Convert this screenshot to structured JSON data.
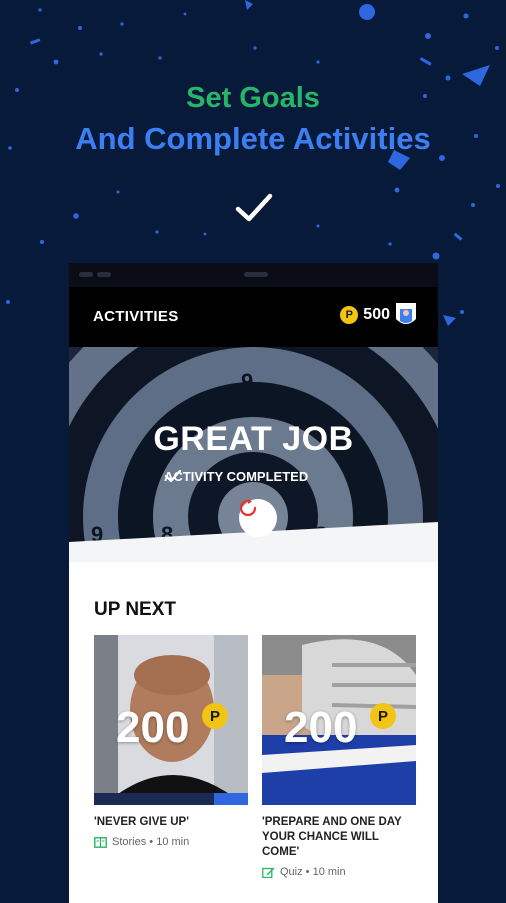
{
  "headline": {
    "line1": "Set Goals",
    "line2": "And Complete Activities"
  },
  "colors": {
    "background": "#071a3a",
    "green": "#27b567",
    "blue": "#3d7ff3",
    "coin": "#f2c414"
  },
  "app": {
    "title": "ACTIVITIES",
    "points": "500",
    "coin_symbol": "P",
    "badge_icon": "jersey-badge-icon"
  },
  "hero": {
    "title": "GREAT JOB",
    "subtitle": "ACTIVITY COMPLETED",
    "replay_icon": "replay-icon"
  },
  "up_next": {
    "heading": "UP NEXT",
    "cards": [
      {
        "points": "200",
        "coin": "P",
        "title": "'NEVER GIVE UP'",
        "meta": "Stories • 10 min",
        "icon": "stories-icon"
      },
      {
        "points": "200",
        "coin": "P",
        "title": "'PREPARE AND ONE DAY YOUR CHANCE WILL COME'",
        "meta": "Quiz • 10 min",
        "icon": "quiz-edit-icon"
      }
    ]
  }
}
